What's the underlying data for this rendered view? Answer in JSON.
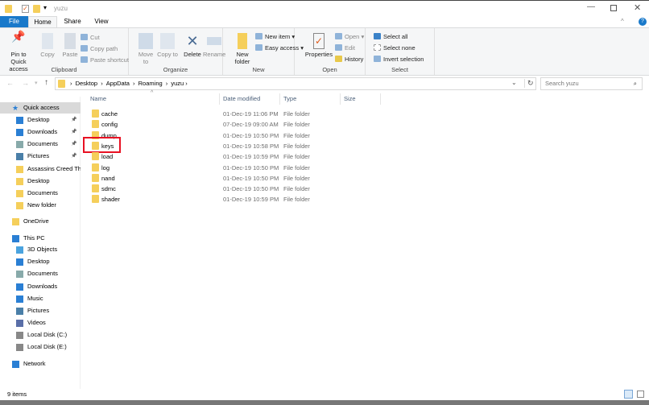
{
  "window": {
    "title": "yuzu"
  },
  "tabs": [
    {
      "label": "File"
    },
    {
      "label": "Home"
    },
    {
      "label": "Share"
    },
    {
      "label": "View"
    }
  ],
  "ribbon": {
    "clipboard": {
      "label": "Clipboard",
      "pin": "Pin to Quick access",
      "copy": "Copy",
      "paste": "Paste",
      "cut": "Cut",
      "copy_path": "Copy path",
      "paste_shortcut": "Paste shortcut"
    },
    "organize": {
      "label": "Organize",
      "move_to": "Move to",
      "copy_to": "Copy to",
      "delete": "Delete",
      "rename": "Rename"
    },
    "new": {
      "label": "New",
      "new_folder": "New folder",
      "new_item": "New item",
      "easy_access": "Easy access"
    },
    "open": {
      "label": "Open",
      "properties": "Properties",
      "open": "Open",
      "edit": "Edit",
      "history": "History"
    },
    "select": {
      "label": "Select",
      "select_all": "Select all",
      "select_none": "Select none",
      "invert": "Invert selection"
    }
  },
  "address": {
    "crumbs": [
      "Desktop",
      "AppData",
      "Roaming",
      "yuzu"
    ]
  },
  "search": {
    "placeholder": "Search yuzu"
  },
  "sidebar": [
    {
      "label": "Quick access",
      "icon": "star-icon",
      "top": true
    },
    {
      "label": "Desktop",
      "icon": "desktop-icon",
      "pinned": true
    },
    {
      "label": "Downloads",
      "icon": "download-icon",
      "pinned": true
    },
    {
      "label": "Documents",
      "icon": "documents-icon",
      "pinned": true
    },
    {
      "label": "Pictures",
      "icon": "pictures-icon",
      "pinned": true
    },
    {
      "label": "Assassins Creed The",
      "icon": "folder-icon"
    },
    {
      "label": "Desktop",
      "icon": "folder-icon"
    },
    {
      "label": "Documents",
      "icon": "folder-icon"
    },
    {
      "label": "New folder",
      "icon": "folder-icon"
    },
    {
      "label": "OneDrive",
      "icon": "folder-icon",
      "top": true
    },
    {
      "label": "This PC",
      "icon": "pc-icon",
      "top": true
    },
    {
      "label": "3D Objects",
      "icon": "3d-objects-icon"
    },
    {
      "label": "Desktop",
      "icon": "desktop-icon"
    },
    {
      "label": "Documents",
      "icon": "documents-icon"
    },
    {
      "label": "Downloads",
      "icon": "download-icon"
    },
    {
      "label": "Music",
      "icon": "music-icon"
    },
    {
      "label": "Pictures",
      "icon": "pictures-icon"
    },
    {
      "label": "Videos",
      "icon": "videos-icon"
    },
    {
      "label": "Local Disk (C:)",
      "icon": "disk-icon"
    },
    {
      "label": "Local Disk (E:)",
      "icon": "disk-icon"
    },
    {
      "label": "Network",
      "icon": "network-icon",
      "top": true
    }
  ],
  "columns": [
    "Name",
    "Date modified",
    "Type",
    "Size"
  ],
  "files": [
    {
      "name": "cache",
      "date": "01-Dec-19 11:06 PM",
      "type": "File folder"
    },
    {
      "name": "config",
      "date": "07-Dec-19 09:00 AM",
      "type": "File folder"
    },
    {
      "name": "dump",
      "date": "01-Dec-19 10:50 PM",
      "type": "File folder"
    },
    {
      "name": "keys",
      "date": "01-Dec-19 10:58 PM",
      "type": "File folder",
      "highlighted": true
    },
    {
      "name": "load",
      "date": "01-Dec-19 10:59 PM",
      "type": "File folder"
    },
    {
      "name": "log",
      "date": "01-Dec-19 10:50 PM",
      "type": "File folder"
    },
    {
      "name": "nand",
      "date": "01-Dec-19 10:50 PM",
      "type": "File folder"
    },
    {
      "name": "sdmc",
      "date": "01-Dec-19 10:50 PM",
      "type": "File folder"
    },
    {
      "name": "shader",
      "date": "01-Dec-19 10:59 PM",
      "type": "File folder"
    }
  ],
  "status": {
    "count": "9 items"
  },
  "colors": {
    "accent": "#1979ca",
    "highlight": "#e81123",
    "folder": "#f5cf5b"
  }
}
